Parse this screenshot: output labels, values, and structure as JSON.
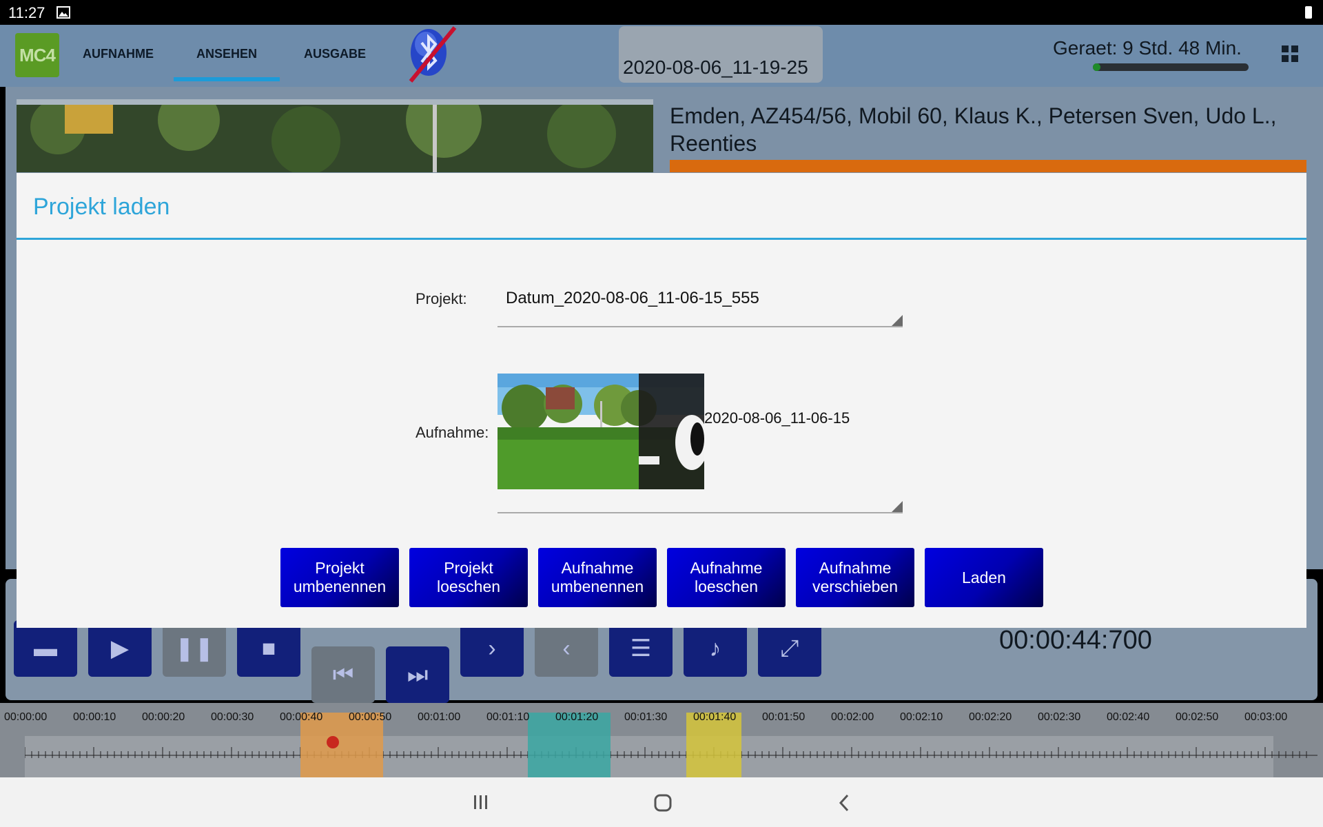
{
  "status_bar": {
    "time": "11:27",
    "icons": [
      "image-icon",
      "battery-icon"
    ]
  },
  "app_bar": {
    "logo": "MC4",
    "tabs": [
      {
        "label": "AUFNAHME",
        "active": false
      },
      {
        "label": "ANSEHEN",
        "active": true
      },
      {
        "label": "AUSGABE",
        "active": false
      }
    ],
    "bluetooth_status": "disabled",
    "file_name": "2020-08-06_11-19-25",
    "device_label": "Geraet: 9 Std. 48 Min.",
    "device_level": 0.05
  },
  "background": {
    "info_text": "Emden, AZ454/56, Mobil 60, Klaus K., Petersen Sven, Udo L., Reenties",
    "current_time": "00:00:44:700"
  },
  "timeline": {
    "labels": [
      "00:00:00",
      "00:00:10",
      "00:00:20",
      "00:00:30",
      "00:00:40",
      "00:00:50",
      "00:01:00",
      "00:01:10",
      "00:01:20",
      "00:01:30",
      "00:01:40",
      "00:01:50",
      "00:02:00",
      "00:02:10",
      "00:02:20",
      "00:02:30",
      "00:02:40",
      "00:02:50",
      "00:03:00"
    ],
    "playhead": "00:00:44",
    "segments": [
      {
        "from": "00:00:40",
        "to": "00:00:52",
        "color": "#e09a4a"
      },
      {
        "from": "00:01:13",
        "to": "00:01:25",
        "color": "#3aa7a2"
      },
      {
        "from": "00:01:36",
        "to": "00:01:44",
        "color": "#d5c43a"
      }
    ]
  },
  "dialog": {
    "title": "Projekt laden",
    "project_label": "Projekt:",
    "project_value": "Datum_2020-08-06_11-06-15_555",
    "recording_label": "Aufnahme:",
    "recording_value": "2020-08-06_11-06-15",
    "buttons": [
      "Projekt\numbenennen",
      "Projekt\nloeschen",
      "Aufnahme\numbenennen",
      "Aufnahme\nloeschen",
      "Aufnahme\nverschieben",
      "Laden"
    ]
  },
  "nav_bar": {
    "icons": [
      "recent-apps-icon",
      "home-icon",
      "back-icon"
    ]
  },
  "colors": {
    "accent": "#2ea5d9",
    "button": "#0000c8",
    "app_bar": "#6e8cab"
  }
}
